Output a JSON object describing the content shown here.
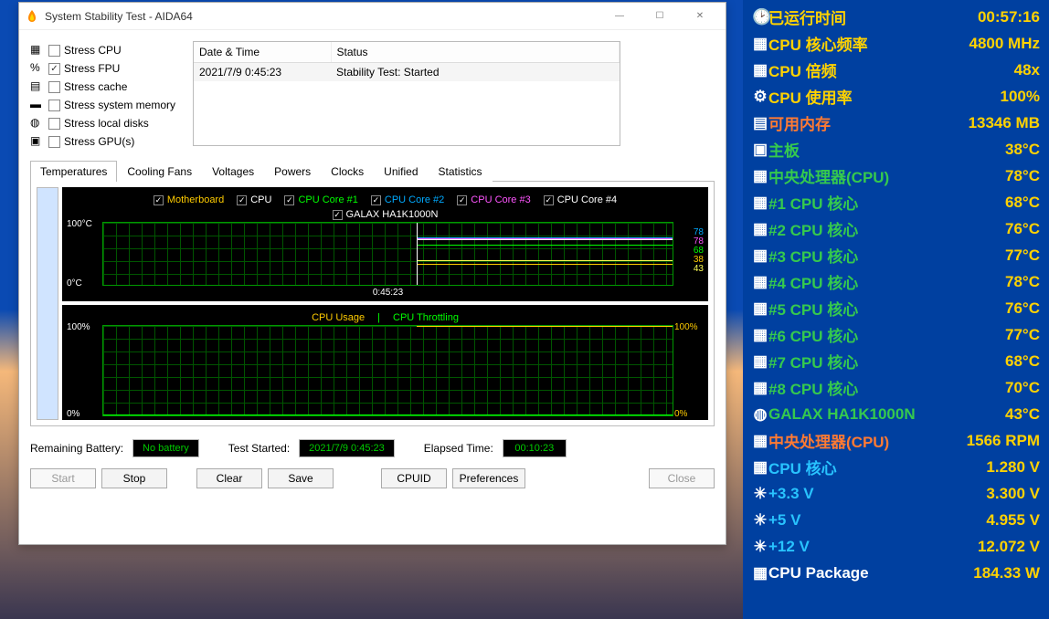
{
  "window": {
    "title": "System Stability Test - AIDA64"
  },
  "stress_options": [
    {
      "label": "Stress CPU",
      "checked": false,
      "icon": "cpu"
    },
    {
      "label": "Stress FPU",
      "checked": true,
      "icon": "fpu"
    },
    {
      "label": "Stress cache",
      "checked": false,
      "icon": "cache"
    },
    {
      "label": "Stress system memory",
      "checked": false,
      "icon": "mem"
    },
    {
      "label": "Stress local disks",
      "checked": false,
      "icon": "disk"
    },
    {
      "label": "Stress GPU(s)",
      "checked": false,
      "icon": "gpu"
    }
  ],
  "log": {
    "headers": [
      "Date & Time",
      "Status"
    ],
    "rows": [
      {
        "datetime": "2021/7/9 0:45:23",
        "status": "Stability Test: Started"
      }
    ]
  },
  "tabs": [
    "Temperatures",
    "Cooling Fans",
    "Voltages",
    "Powers",
    "Clocks",
    "Unified",
    "Statistics"
  ],
  "active_tab": "Temperatures",
  "temp_graph": {
    "legend": [
      {
        "label": "Motherboard",
        "color": "#ffcc00"
      },
      {
        "label": "CPU",
        "color": "#ffffff"
      },
      {
        "label": "CPU Core #1",
        "color": "#00ff00"
      },
      {
        "label": "CPU Core #2",
        "color": "#00aaff"
      },
      {
        "label": "CPU Core #3",
        "color": "#ff55ff"
      },
      {
        "label": "CPU Core #4",
        "color": "#ffffff"
      }
    ],
    "legend2": [
      {
        "label": "GALAX HA1K1000N",
        "color": "#ffffff"
      }
    ],
    "y_top": "100°C",
    "y_bot": "0°C",
    "r_vals": [
      "78",
      "78",
      "68",
      "38",
      "43"
    ],
    "r_colors": [
      "#00aaff",
      "#ff55ff",
      "#00ff00",
      "#ffcc00",
      "#ffff55"
    ],
    "time_label": "0:45:23"
  },
  "usage_graph": {
    "legend": [
      {
        "label": "CPU Usage",
        "color": "#ffcc00"
      },
      {
        "text_sep": "|"
      },
      {
        "label": "CPU Throttling",
        "color": "#00ff00"
      }
    ],
    "y_top": "100%",
    "y_bot": "0%",
    "r_top": "100%",
    "r_bot": "0%"
  },
  "status": {
    "battery_label": "Remaining Battery:",
    "battery_value": "No battery",
    "started_label": "Test Started:",
    "started_value": "2021/7/9 0:45:23",
    "elapsed_label": "Elapsed Time:",
    "elapsed_value": "00:10:23"
  },
  "buttons": {
    "start": "Start",
    "stop": "Stop",
    "clear": "Clear",
    "save": "Save",
    "cpuid": "CPUID",
    "prefs": "Preferences",
    "close": "Close"
  },
  "sensor_rows": [
    {
      "icon": "🕑",
      "label": "已运行时间",
      "value": "00:57:16",
      "lcls": "yellow",
      "vcls": "yellow"
    },
    {
      "icon": "▦",
      "label": "CPU 核心频率",
      "value": "4800 MHz",
      "lcls": "yellow",
      "vcls": "yellow"
    },
    {
      "icon": "▦",
      "label": "CPU 倍频",
      "value": "48x",
      "lcls": "yellow",
      "vcls": "yellow"
    },
    {
      "icon": "⚙",
      "label": "CPU 使用率",
      "value": "100%",
      "lcls": "yellow",
      "vcls": "yellow"
    },
    {
      "icon": "▤",
      "label": "可用内存",
      "value": "13346 MB",
      "lcls": "orange",
      "vcls": "yellow"
    },
    {
      "icon": "▣",
      "label": "主板",
      "value": "38°C",
      "lcls": "green",
      "vcls": "yellow"
    },
    {
      "icon": "▦",
      "label": "中央处理器(CPU)",
      "value": "78°C",
      "lcls": "green",
      "vcls": "yellow"
    },
    {
      "icon": "▦",
      "label": "#1 CPU 核心",
      "value": "68°C",
      "lcls": "green",
      "vcls": "yellow"
    },
    {
      "icon": "▦",
      "label": "#2 CPU 核心",
      "value": "76°C",
      "lcls": "green",
      "vcls": "yellow"
    },
    {
      "icon": "▦",
      "label": "#3 CPU 核心",
      "value": "77°C",
      "lcls": "green",
      "vcls": "yellow"
    },
    {
      "icon": "▦",
      "label": "#4 CPU 核心",
      "value": "78°C",
      "lcls": "green",
      "vcls": "yellow"
    },
    {
      "icon": "▦",
      "label": "#5 CPU 核心",
      "value": "76°C",
      "lcls": "green",
      "vcls": "yellow"
    },
    {
      "icon": "▦",
      "label": "#6 CPU 核心",
      "value": "77°C",
      "lcls": "green",
      "vcls": "yellow"
    },
    {
      "icon": "▦",
      "label": "#7 CPU 核心",
      "value": "68°C",
      "lcls": "green",
      "vcls": "yellow"
    },
    {
      "icon": "▦",
      "label": "#8 CPU 核心",
      "value": "70°C",
      "lcls": "green",
      "vcls": "yellow"
    },
    {
      "icon": "◍",
      "label": "GALAX HA1K1000N",
      "value": "43°C",
      "lcls": "green",
      "vcls": "yellow"
    },
    {
      "icon": "▦",
      "label": "中央处理器(CPU)",
      "value": "1566 RPM",
      "lcls": "orange",
      "vcls": "yellow"
    },
    {
      "icon": "▦",
      "label": "CPU 核心",
      "value": "1.280 V",
      "lcls": "cyan",
      "vcls": "yellow"
    },
    {
      "icon": "✳",
      "label": "+3.3 V",
      "value": "3.300 V",
      "lcls": "cyan",
      "vcls": "yellow"
    },
    {
      "icon": "✳",
      "label": "+5 V",
      "value": "4.955 V",
      "lcls": "cyan",
      "vcls": "yellow"
    },
    {
      "icon": "✳",
      "label": "+12 V",
      "value": "12.072 V",
      "lcls": "cyan",
      "vcls": "yellow"
    },
    {
      "icon": "▦",
      "label": "CPU Package",
      "value": "184.33 W",
      "lcls": "",
      "vcls": "yellow"
    }
  ],
  "chart_data": [
    {
      "type": "line",
      "title": "Temperatures",
      "xlabel": "time",
      "ylabel": "°C",
      "ylim": [
        0,
        100
      ],
      "x_tick": "0:45:23",
      "series": [
        {
          "name": "Motherboard",
          "current": 38,
          "color": "#ffcc00"
        },
        {
          "name": "CPU",
          "current": 78,
          "color": "#ffffff"
        },
        {
          "name": "CPU Core #1",
          "current": 68,
          "color": "#00ff00"
        },
        {
          "name": "CPU Core #2",
          "current": 78,
          "color": "#00aaff"
        },
        {
          "name": "CPU Core #3",
          "current": 78,
          "color": "#ff55ff"
        },
        {
          "name": "CPU Core #4",
          "current": 78,
          "color": "#ffffff"
        },
        {
          "name": "GALAX HA1K1000N",
          "current": 43,
          "color": "#ffff55"
        }
      ]
    },
    {
      "type": "line",
      "title": "CPU Usage | CPU Throttling",
      "xlabel": "time",
      "ylabel": "%",
      "ylim": [
        0,
        100
      ],
      "series": [
        {
          "name": "CPU Usage",
          "current": 100,
          "color": "#ffcc00"
        },
        {
          "name": "CPU Throttling",
          "current": 0,
          "color": "#00ff00"
        }
      ]
    }
  ]
}
